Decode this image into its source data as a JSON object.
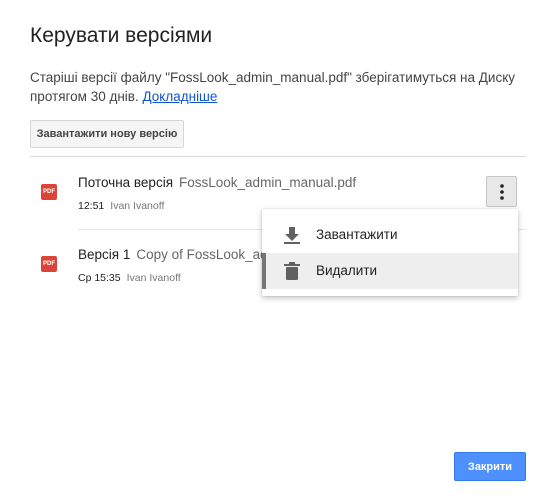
{
  "dialog": {
    "title": "Керувати версіями",
    "description_text": "Старіші версії файлу \"FossLook_admin_manual.pdf\" зберігатимуться на Диску протягом 30 днів.",
    "learn_more_link": "Докладніше",
    "upload_button": "Завантажити нову версію",
    "close_button": "Закрити"
  },
  "versions": [
    {
      "label": "Поточна версія",
      "file_name": "FossLook_admin_manual.pdf",
      "time": "12:51",
      "user": "Ivan Ivanoff",
      "icon": "pdf-icon",
      "icon_text": "PDF"
    },
    {
      "label": "Версія 1",
      "file_name": "Copy of FossLook_adm",
      "time": "Ср 15:35",
      "user": "Ivan Ivanoff",
      "icon": "pdf-icon",
      "icon_text": "PDF"
    }
  ],
  "context_menu": {
    "items": [
      {
        "label": "Завантажити",
        "icon": "download-icon"
      },
      {
        "label": "Видалити",
        "icon": "trash-icon",
        "highlighted": true
      }
    ]
  },
  "colors": {
    "primary_button": "#4d90fe",
    "link": "#1155cc",
    "pdf_icon": "#db4437"
  }
}
